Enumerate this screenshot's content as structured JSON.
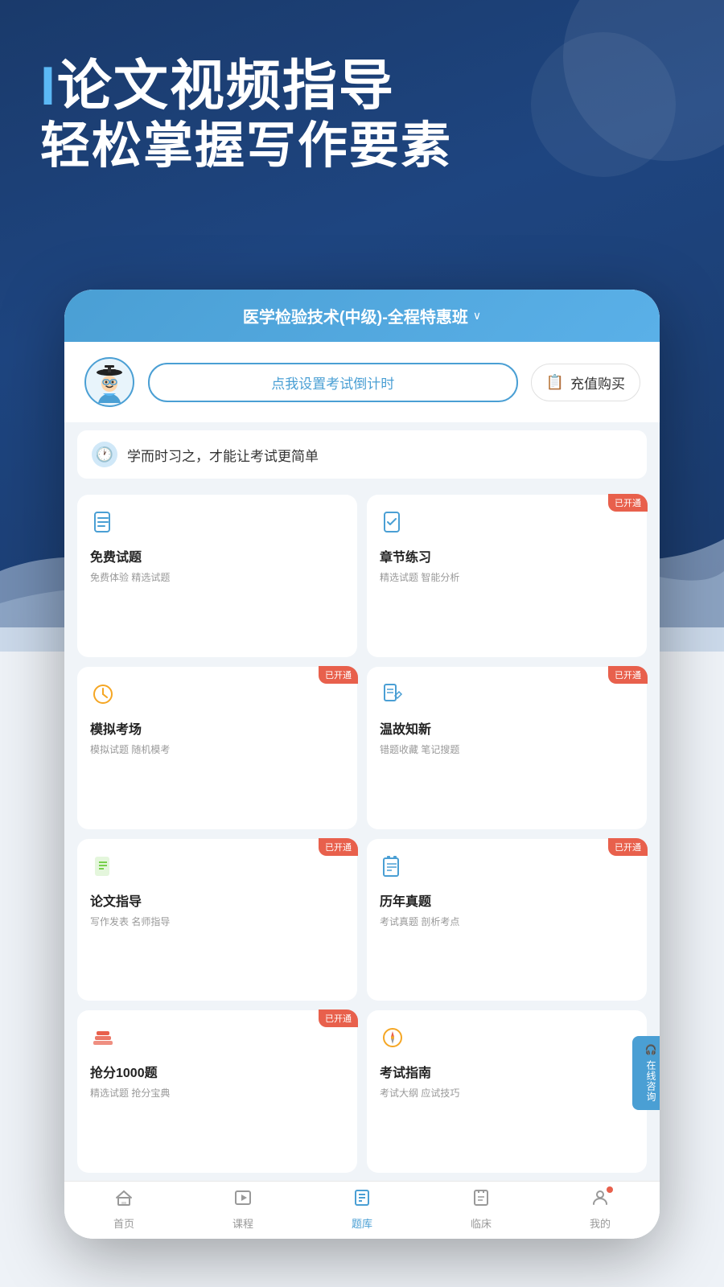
{
  "hero": {
    "line1_prefix": "I",
    "line1_main": "论文视频指导",
    "line2": "轻松掌握写作要素"
  },
  "app": {
    "header": {
      "title": "医学检验技术(中级)-全程特惠班",
      "dropdown_arrow": "∨"
    },
    "profile": {
      "countdown_btn": "点我设置考试倒计时",
      "recharge_btn": "充值购买"
    },
    "motto": "学而时习之，才能让考试更简单",
    "cards": [
      {
        "id": "free-questions",
        "title": "免费试题",
        "desc": "免费体验 精选试题",
        "badge": "",
        "icon_type": "doc"
      },
      {
        "id": "chapter-practice",
        "title": "章节练习",
        "desc": "精选试题 智能分析",
        "badge": "已开通",
        "icon_type": "doc-check"
      },
      {
        "id": "mock-exam",
        "title": "模拟考场",
        "desc": "模拟试题 随机模考",
        "badge": "已开通",
        "icon_type": "clock"
      },
      {
        "id": "review",
        "title": "温故知新",
        "desc": "错题收藏 笔记搜题",
        "badge": "已开通",
        "icon_type": "doc-edit"
      },
      {
        "id": "paper-guide",
        "title": "论文指导",
        "desc": "写作发表 名师指导",
        "badge": "已开通",
        "icon_type": "paper"
      },
      {
        "id": "history-questions",
        "title": "历年真题",
        "desc": "考试真题 剖析考点",
        "badge": "已开通",
        "icon_type": "history"
      },
      {
        "id": "grab-score",
        "title": "抢分1000题",
        "desc": "精选试题 抢分宝典",
        "badge": "已开通",
        "icon_type": "stack"
      },
      {
        "id": "exam-guide",
        "title": "考试指南",
        "desc": "考试大纲 应试技巧",
        "badge": "",
        "icon_type": "compass"
      }
    ],
    "online_chat": "在线咨询",
    "nav": [
      {
        "id": "home",
        "label": "首页",
        "icon": "⌂",
        "active": false
      },
      {
        "id": "course",
        "label": "课程",
        "icon": "▷",
        "active": false
      },
      {
        "id": "questions",
        "label": "题库",
        "icon": "≡",
        "active": true
      },
      {
        "id": "clinical",
        "label": "临床",
        "icon": "☰",
        "active": false
      },
      {
        "id": "mine",
        "label": "我的",
        "icon": "○",
        "active": false,
        "has_badge": true
      }
    ]
  }
}
